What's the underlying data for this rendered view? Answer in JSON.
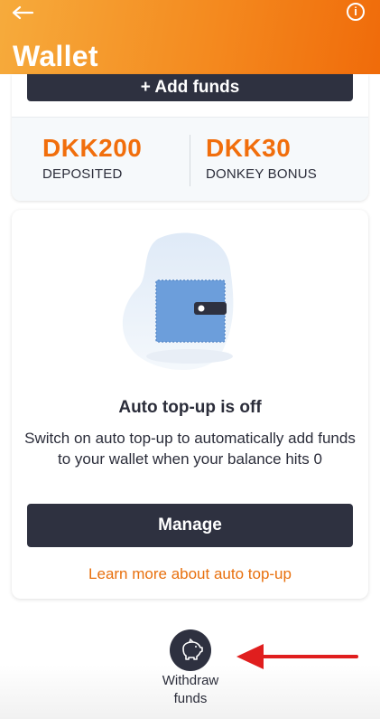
{
  "header": {
    "title": "Wallet",
    "back_icon": "arrow-left-icon",
    "info_icon": "info-icon",
    "info_glyph": "i"
  },
  "top_card": {
    "add_funds_label": "+ Add funds",
    "deposited": {
      "value": "DKK200",
      "label": "DEPOSITED"
    },
    "bonus": {
      "value": "DKK30",
      "label": "DONKEY BONUS"
    }
  },
  "auto_topup": {
    "illustration": "wallet-icon",
    "title": "Auto top-up is off",
    "description": "Switch on auto top-up to automatically add funds to your wallet when your balance hits 0",
    "manage_label": "Manage",
    "learn_more_label": "Learn more about auto top-up"
  },
  "bottom": {
    "withdraw_icon": "piggy-bank-icon",
    "withdraw_label": "Withdraw funds"
  },
  "colors": {
    "accent_orange": "#f16e0c",
    "dark_button": "#2e3140",
    "annotation_arrow": "#e01e1e"
  }
}
